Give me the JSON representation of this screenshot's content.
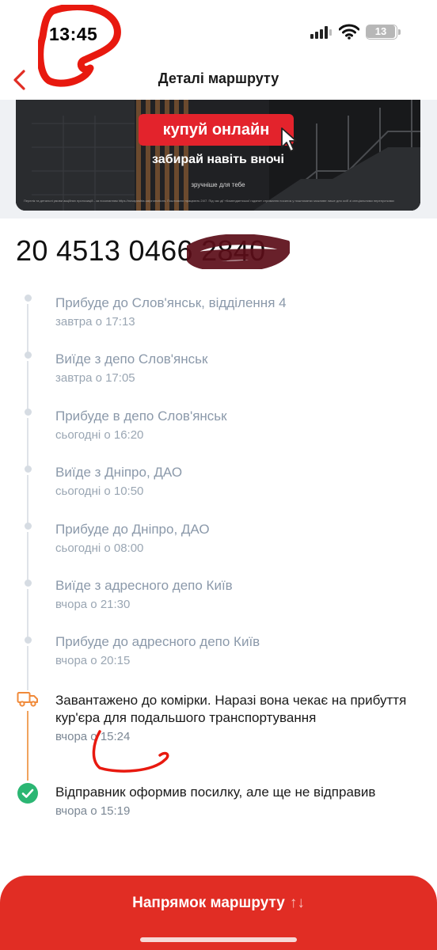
{
  "status_bar": {
    "time": "13:45",
    "battery": "13"
  },
  "header": {
    "title": "Деталі маршруту"
  },
  "banner": {
    "cta": "купуй онлайн",
    "subtitle": "забирай навіть вночі",
    "small_text": "зручніше для тебе",
    "fine_print": "Перелік та детальні умови акційних пропозицій - за посиланням https://novaposhta.ua/promotions. Поштомати працюють 24/7. Під час дії «Комендантської години» отримання посилок у поштоматах можливе лише для осіб зі спеціальними перепустками"
  },
  "tracking_number": "20 4513 0466 2840",
  "timeline": [
    {
      "title": "Прибуде до Слов'янськ, відділення 4",
      "time": "завтра о 17:13",
      "state": "pending"
    },
    {
      "title": "Виїде з депо Слов'янськ",
      "time": "завтра о 17:05",
      "state": "pending"
    },
    {
      "title": "Прибуде в депо Слов'янськ",
      "time": "сьогодні о 16:20",
      "state": "pending"
    },
    {
      "title": "Виїде з Дніпро, ДАО",
      "time": "сьогодні о 10:50",
      "state": "pending"
    },
    {
      "title": "Прибуде до Дніпро, ДАО",
      "time": "сьогодні о 08:00",
      "state": "pending"
    },
    {
      "title": "Виїде з адресного депо Київ",
      "time": "вчора о 21:30",
      "state": "pending"
    },
    {
      "title": "Прибуде до адресного депо Київ",
      "time": "вчора о 20:15",
      "state": "pending"
    },
    {
      "title": "Завантажено до комірки. Наразі вона чекає на прибуття кур'єра для подальшого транспортування",
      "time": "вчора о 15:24",
      "state": "current"
    },
    {
      "title": "Відправник оформив посилку, але ще не відправив",
      "time": "вчора о 15:19",
      "state": "done"
    }
  ],
  "bottom_button": {
    "label": "Напрямок маршруту",
    "arrows": "↑↓"
  },
  "colors": {
    "accent": "#e12d24",
    "truck": "#f08a3a",
    "check": "#2bb673",
    "muted_text": "#8b99aa",
    "annotation": "#e8190f"
  },
  "icons": [
    "back-chevron-icon",
    "signal-icon",
    "wifi-icon",
    "battery-icon",
    "cursor-icon",
    "truck-icon",
    "check-circle-icon"
  ]
}
